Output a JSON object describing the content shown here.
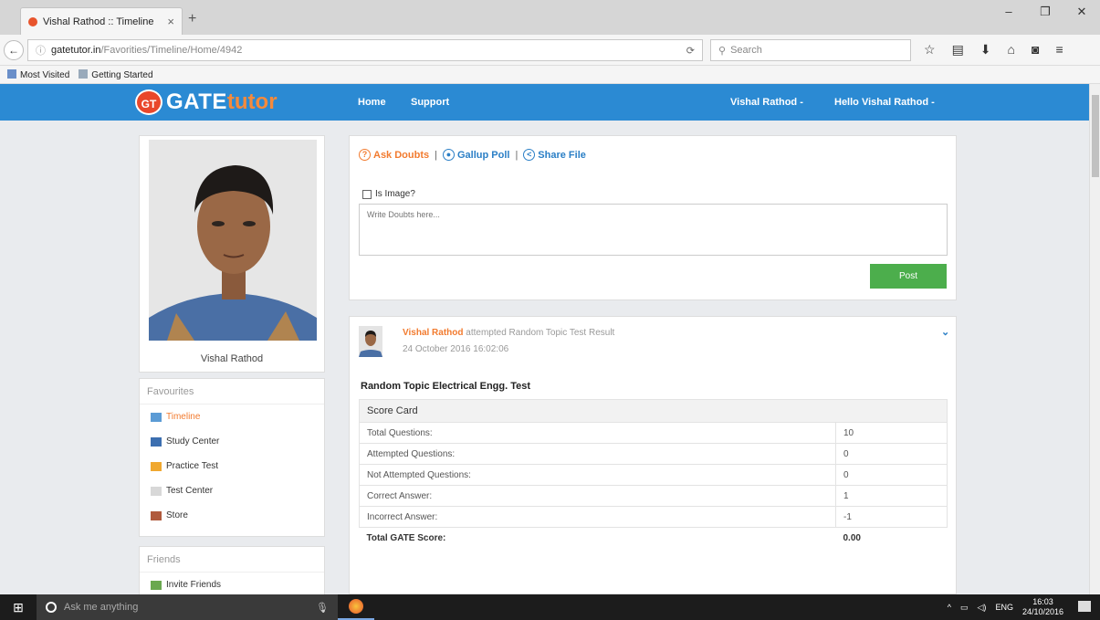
{
  "browser": {
    "tab_title": "Vishal Rathod :: Timeline",
    "url_host": "gatetutor.in",
    "url_path": "/Favorities/Timeline/Home/4942",
    "search_placeholder": "Search",
    "bookmarks": [
      "Most Visited",
      "Getting Started"
    ]
  },
  "site": {
    "logo_badge": "GT",
    "logo_gate": "GATE",
    "logo_tutor": "tutor",
    "nav": {
      "home": "Home",
      "support": "Support",
      "user_menu": "Vishal Rathod -",
      "hello_menu": "Hello Vishal Rathod -"
    }
  },
  "profile": {
    "name": "Vishal Rathod"
  },
  "favourites": {
    "heading": "Favourites",
    "items": [
      "Timeline",
      "Study Center",
      "Practice Test",
      "Test Center",
      "Store"
    ]
  },
  "friends": {
    "heading": "Friends",
    "items": [
      "Invite Friends"
    ]
  },
  "compose": {
    "tabs": [
      "Ask Doubts",
      "Gallup Poll",
      "Share File"
    ],
    "separator": "|",
    "is_image_label": "Is Image?",
    "placeholder": "Write Doubts here...",
    "post_button": "Post"
  },
  "post": {
    "author": "Vishal Rathod",
    "action": "attempted Random Topic Test Result",
    "timestamp": "24 October 2016 16:02:06",
    "title": "Random Topic Electrical Engg. Test",
    "table_header": "Score Card",
    "rows": [
      {
        "label": "Total Questions:",
        "value": "10"
      },
      {
        "label": "Attempted Questions:",
        "value": "0"
      },
      {
        "label": "Not Attempted Questions:",
        "value": "0"
      },
      {
        "label": "Correct Answer:",
        "value": "1"
      },
      {
        "label": "Incorrect Answer:",
        "value": "-1"
      }
    ],
    "total_label": "Total GATE Score:",
    "total_value": "0.00"
  },
  "taskbar": {
    "search_placeholder": "Ask me anything",
    "language": "ENG",
    "time": "16:03",
    "date": "24/10/2016"
  },
  "colors": {
    "header_blue": "#2b8ad3",
    "accent_orange": "#f27b2f",
    "post_green": "#4cae4c"
  }
}
